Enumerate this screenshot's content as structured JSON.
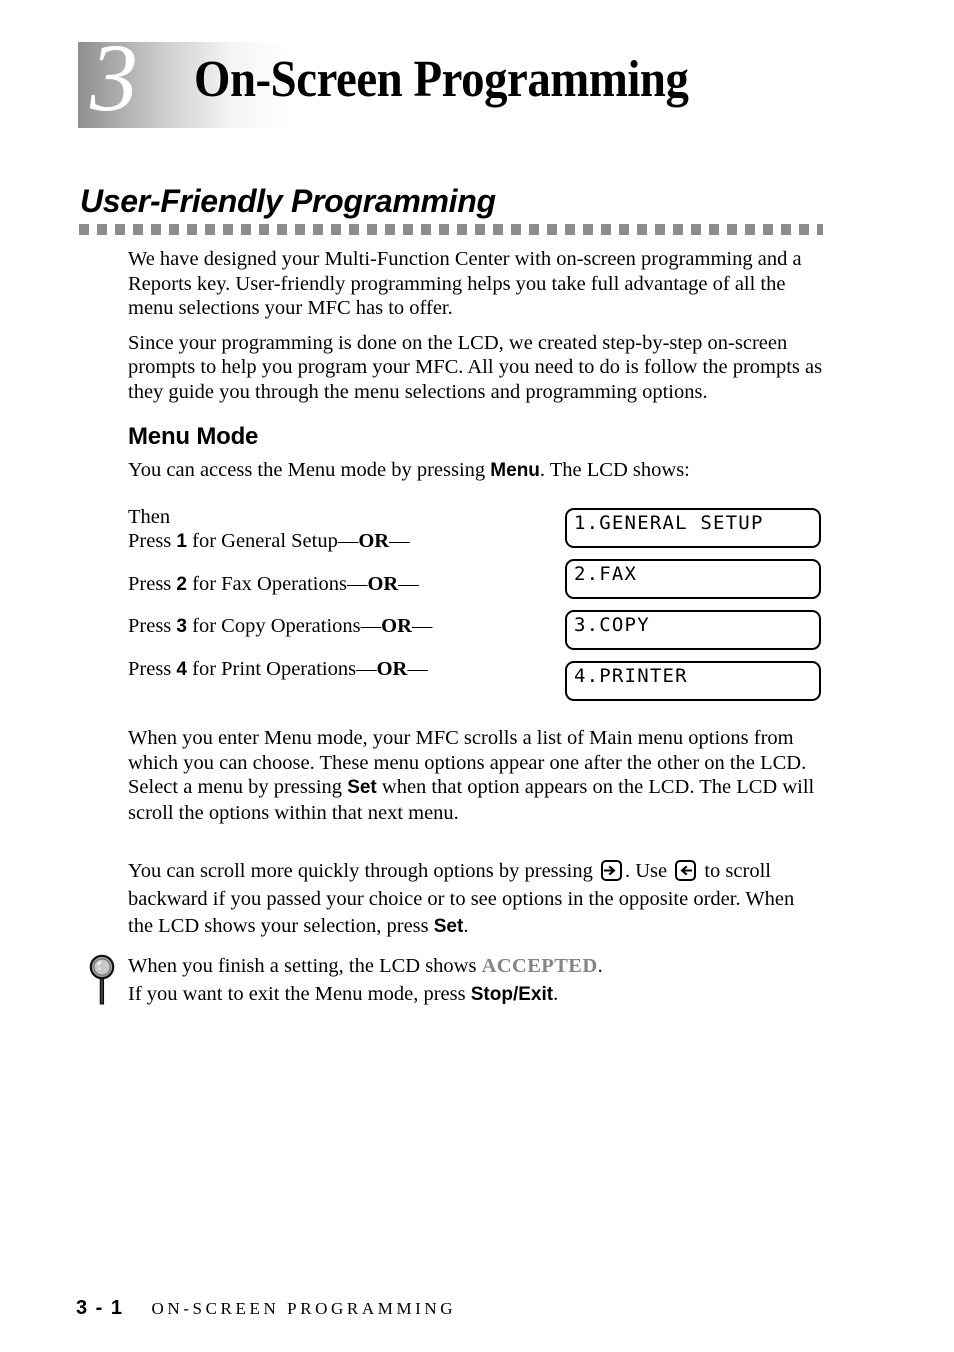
{
  "chapter": {
    "number": "3",
    "title": "On-Screen Programming"
  },
  "section": {
    "heading": "User-Friendly Programming"
  },
  "intro": {
    "paragraph_1": "We have designed your Multi-Function Center with on-screen programming and a Reports key. User-friendly programming helps you take full advantage of all the menu selections your MFC has to offer.",
    "paragraph_2": "Since your programming is done on the LCD, we created step-by-step on-screen prompts to help you program your MFC. All you need to do is follow the prompts as they guide you through the menu selections and programming options."
  },
  "menu_mode": {
    "heading": "Menu Mode",
    "access_text_before": "You can access the Menu mode by pressing ",
    "access_key": "Menu",
    "access_text_after": ". The LCD shows:",
    "then_label": "Then",
    "press_items": [
      {
        "prefix": "Press ",
        "key": "1",
        "middle": " for General Setup",
        "dash_before": "—",
        "or": "OR",
        "dash_after": "—"
      },
      {
        "prefix": "Press ",
        "key": "2",
        "middle": " for Fax Operations",
        "dash_before": "—",
        "or": "OR",
        "dash_after": "—"
      },
      {
        "prefix": "Press ",
        "key": "3",
        "middle": " for Copy Operations",
        "dash_before": "—",
        "or": "OR",
        "dash_after": "—"
      },
      {
        "prefix": "Press ",
        "key": "4",
        "middle": " for Print Operations",
        "dash_before": "—",
        "or": "OR",
        "dash_after": "—"
      }
    ],
    "lcd_screens": [
      "1.GENERAL SETUP",
      "2.FAX",
      "3.COPY",
      "4.PRINTER"
    ]
  },
  "scroll_info": {
    "paragraph_before_set": "When you enter Menu mode, your MFC scrolls a list of Main menu options from which you can choose. These menu options appear one after the other on the LCD. Select a menu by pressing ",
    "set_key": "Set",
    "paragraph_after_set": " when that option appears on the LCD. The LCD will scroll the options within that next menu.",
    "quick_scroll_1": "You can scroll more quickly through options by pressing ",
    "right_arrow_icon": "right-arrow-key-icon",
    "quick_scroll_2": ". Use ",
    "left_arrow_icon": "left-arrow-key-icon",
    "quick_scroll_3": " to scroll backward if you passed your choice or to see options in the opposite order. When the LCD shows your selection, press ",
    "quick_scroll_set_key": "Set",
    "quick_scroll_4": "."
  },
  "tip": {
    "icon": "magnifying-glass-icon",
    "line_1_before": "When you finish a setting, the LCD shows ",
    "line_1_status": "ACCEPTED",
    "line_1_after": ".",
    "line_2_before": "If you want to exit the Menu mode, press ",
    "line_2_key": "Stop/Exit",
    "line_2_after": "."
  },
  "footer": {
    "page": "3 - 1",
    "title": "ON-SCREEN PROGRAMMING"
  },
  "colors": {
    "rule_gray": "#8c8c8c",
    "accepted_gray": "#848484",
    "badge_gradient_start": "#8e8e8e",
    "badge_gradient_end": "#ffffff"
  }
}
